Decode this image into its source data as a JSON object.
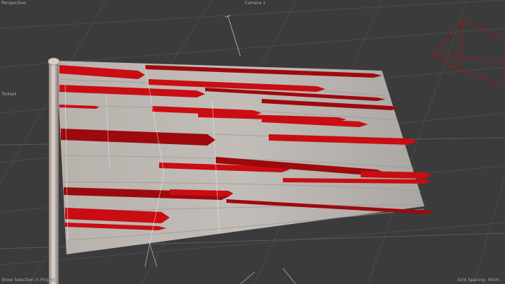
{
  "viewport": {
    "top_left_label": "Perspective",
    "top_center_label": "Camera 1",
    "mid_left_label": "Toolset",
    "bottom_left_label": "Show Selection in Project",
    "bottom_right_label": "Grid Spacing: 50cm"
  },
  "colors": {
    "background": "#3b3b3b",
    "grid": "#4a4a4a",
    "flag_cloth": "#b9b5b1",
    "flag_stripe": "#c90d12",
    "pole": "#c9bdb3",
    "camera_frustum": "#a51818",
    "gizmo_lines": "#bdbdbd"
  },
  "scene": {
    "object": "flag",
    "icons": [
      "camera-frustum-icon",
      "axis-gizmo-icon"
    ]
  }
}
